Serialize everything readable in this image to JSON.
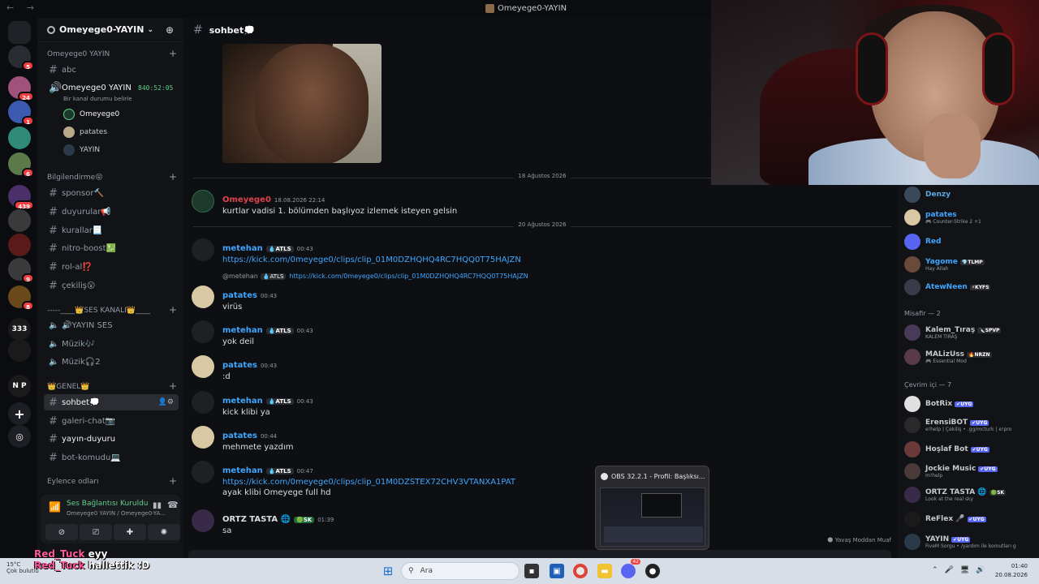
{
  "window": {
    "title": "Omeyege0-YAYIN",
    "nav_glyph": "←  →"
  },
  "rail": {
    "servers": [
      {
        "icon": "discord-icon",
        "color": "#1f2127",
        "badge": ""
      },
      {
        "icon": "server-e-icon",
        "color": "#2a2c33",
        "badge": "5"
      },
      {
        "icon": "server-avatar-icon",
        "color": "#a0527a",
        "badge": "24"
      },
      {
        "icon": "server-avatar-icon",
        "color": "#3c5ab0",
        "badge": "1"
      },
      {
        "icon": "server-avatar-icon",
        "color": "#2f8a78",
        "badge": ""
      },
      {
        "icon": "server-avatar-icon",
        "color": "#5a7a4a",
        "badge": "6"
      },
      {
        "icon": "server-avatar-icon",
        "color": "#4b2f6a",
        "badge": "439"
      },
      {
        "icon": "server-avatar-icon",
        "color": "#3a3a3a",
        "badge": ""
      },
      {
        "icon": "server-avatar-icon",
        "color": "#5a1a1a",
        "badge": ""
      },
      {
        "icon": "server-avatar-icon",
        "color": "#3a3a3a",
        "badge": "9"
      },
      {
        "icon": "server-avatar-icon",
        "color": "#6a4a1a",
        "badge": "8"
      },
      {
        "icon": "server-avatar-icon",
        "color": "#1a1a1a",
        "badge": ""
      },
      {
        "icon": "server-avatar-icon",
        "color": "#1a1a1a",
        "badge": ""
      },
      {
        "icon": "server-np-icon",
        "color": "#1a1a1a",
        "badge": ""
      }
    ],
    "labels": [
      "",
      "",
      "",
      "",
      "",
      "",
      "",
      "",
      "",
      "",
      "",
      "333",
      "",
      "N P"
    ]
  },
  "sidebar": {
    "guild_name": "Omeyege0-YAYIN",
    "cat1": "Omeyege0 YAYIN",
    "ch_abc": "abc",
    "live_channel": "Omeyege0 YAYIN",
    "live_time": "840:52:05",
    "live_status": "Bir kanal durumu belirle",
    "vc_users": [
      "Omeyege0",
      "patates",
      "YAYIN"
    ],
    "cat2": "Bilgilendirme😝",
    "channels2": [
      "sponsor🔨",
      "duyurular📢",
      "kurallar📃",
      "nitro-boost💹",
      "rol-al⁉️",
      "çekiliş😮"
    ],
    "cat3": "-----____👑SES KANALI👑____",
    "voice_channels": [
      "🔊YAYIN SES",
      "Müzik🎶",
      "Müzik🎧2"
    ],
    "cat4": "👑GENEL👑",
    "channels4": [
      "sohbet💭",
      "galeri-chat📷",
      "yayın-duyuru",
      "bot-komudu💻"
    ],
    "cat5": "Eylence odları"
  },
  "voice_panel": {
    "status": "Ses Bağlantısı Kuruldu",
    "sub": "Omeyege0 YAYIN / Omeyege0-YA..."
  },
  "chat": {
    "channel": "sohbet💭",
    "date1": "18 Ağustos 2026",
    "date2": "20 Ağustos 2026",
    "m1": {
      "name": "Omeyege0",
      "ts": "18.08.2026 22:14",
      "text": "kurtlar vadisi 1. bölümden başlıyoz izlemek isteyen gelsin",
      "color": "#e0424e"
    },
    "m2": {
      "name": "metehan",
      "tag": "💧ATLS",
      "ts": "00:43",
      "link": "https://kick.com/0meyege0/clips/clip_01M0DZHQHQ4RC7HQQ0T75HAJZN",
      "color": "#3ea6ff"
    },
    "reply": {
      "name": "@metehan",
      "tag": "💧ATLS",
      "link": "https://kick.com/0meyege0/clips/clip_01M0DZHQHQ4RC7HQQ0T75HAJZN"
    },
    "m3": {
      "name": "patates",
      "ts": "00:43",
      "text": "virüs",
      "color": "#3ea6ff"
    },
    "m4": {
      "name": "metehan",
      "tag": "💧ATLS",
      "ts": "00:43",
      "text": "yok deil",
      "color": "#3ea6ff"
    },
    "m5": {
      "name": "patates",
      "ts": "00:43",
      "text": ":d",
      "color": "#3ea6ff"
    },
    "m6": {
      "name": "metehan",
      "tag": "💧ATLS",
      "ts": "00:43",
      "text": "kick klibi ya",
      "color": "#3ea6ff"
    },
    "m7": {
      "name": "patates",
      "ts": "00:44",
      "text": "mehmete yazdım",
      "color": "#3ea6ff"
    },
    "m8": {
      "name": "metehan",
      "tag": "💧ATLS",
      "ts": "00:47",
      "link": "https://kick.com/0meyege0/clips/clip_01M0DZSTEX72CHV3VTANXA1PAT",
      "text": "ayak klibi Omeyege full hd",
      "color": "#3ea6ff"
    },
    "m9": {
      "name": "ORTZ TASTA 🌐",
      "tag": "🟢SK",
      "ts": "01:39",
      "text": "sa",
      "color": "#dbdee1"
    },
    "typing": "🌑 Yavaş Moddan Muaf"
  },
  "members": {
    "top": [
      {
        "name": "Denzy",
        "status": "",
        "tag": "",
        "color": "#5aa8e0"
      },
      {
        "name": "patates",
        "status": "🎮 Counter-Strike 2 +1",
        "tag": "",
        "color": "#3ea6ff"
      },
      {
        "name": "Red",
        "status": "",
        "tag": "",
        "color": "#3ea6ff"
      },
      {
        "name": "Yagome",
        "status": "Hay Allah",
        "tag": "💎TLMP",
        "color": "#3ea6ff"
      },
      {
        "name": "AtewNeen",
        "status": "",
        "tag": "⚡KYFS",
        "color": "#3ea6ff"
      }
    ],
    "cat_guest": "Misafir — 2",
    "guests": [
      {
        "name": "Kalem_Tıraş",
        "status": "KALEM TIRAŞ",
        "tag": "🔪SPVP"
      },
      {
        "name": "MALizUss",
        "status": "🎮 Essential Mod",
        "tag": "🔥NRZN"
      }
    ],
    "cat_online": "Çevrim içi — 7",
    "online": [
      {
        "name": "BotRix",
        "status": "",
        "tag": "✔UYG"
      },
      {
        "name": "ErensiBOT",
        "status": "e!help | Çekiliş • .gg/mcturk | e!pro",
        "tag": "✔UYG"
      },
      {
        "name": "Hoşlaf Bot",
        "status": "",
        "tag": "✔UYG"
      },
      {
        "name": "Jockie Music",
        "status": "m!help",
        "tag": "✔UYG"
      },
      {
        "name": "ORTZ TASTA 🌐",
        "status": "Look at the real sky",
        "tag": "🟢SK"
      },
      {
        "name": "ReFlex 🎤",
        "status": "",
        "tag": "✔UYG"
      },
      {
        "name": "YAYIN",
        "status": "FiveM Sorgu • /yardım ile komutları g",
        "tag": "✔UYG"
      }
    ]
  },
  "obs_popup": {
    "title": "OBS 32.2.1 - Profil: Başlıksı..."
  },
  "taskbar": {
    "weather": "15°C",
    "weather_sub": "Çok bulutlu",
    "search_placeholder": "Ara",
    "time": "01:40",
    "date": "20.08.2026",
    "discord_badge": "42"
  },
  "overlay": {
    "l1_user": "Red_Tuck",
    "l1_text": "eyy",
    "l2_user": "Red_Tuck",
    "l2_text": "hallettik :D"
  }
}
